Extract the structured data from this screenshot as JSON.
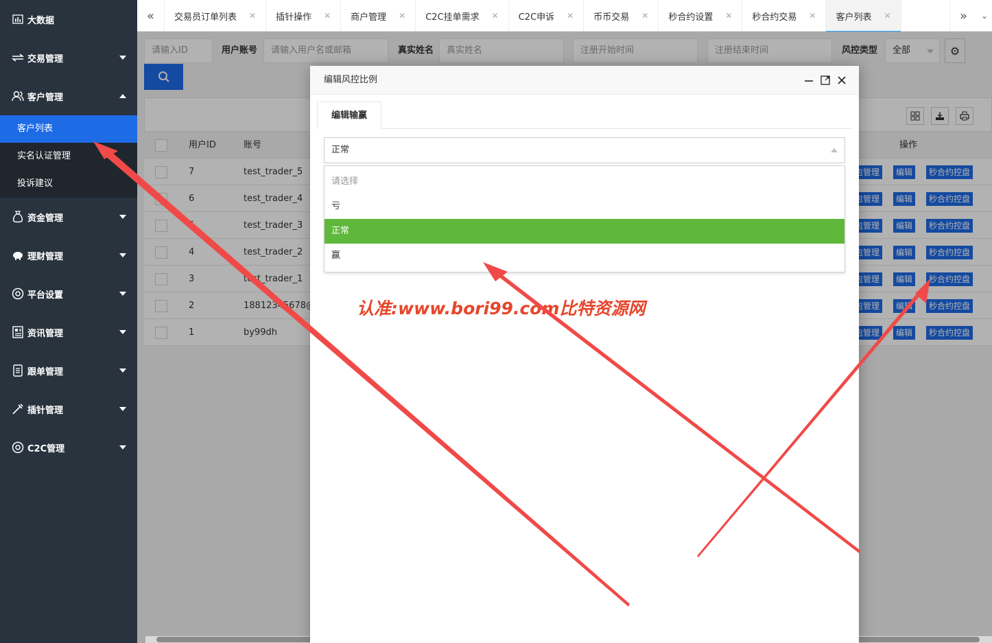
{
  "sidebar": {
    "items": [
      {
        "label": "大数据",
        "icon": "bar-chart-icon"
      },
      {
        "label": "交易管理",
        "icon": "exchange-icon"
      },
      {
        "label": "客户管理",
        "icon": "users-icon"
      },
      {
        "label": "资金管理",
        "icon": "money-bag-icon"
      },
      {
        "label": "理财管理",
        "icon": "piggy-bank-icon"
      },
      {
        "label": "平台设置",
        "icon": "target-icon"
      },
      {
        "label": "资讯管理",
        "icon": "news-icon"
      },
      {
        "label": "跟单管理",
        "icon": "document-icon"
      },
      {
        "label": "插针管理",
        "icon": "needle-icon"
      },
      {
        "label": "C2C管理",
        "icon": "target-icon"
      }
    ],
    "submenu": [
      "客户列表",
      "实名认证管理",
      "投诉建议"
    ]
  },
  "tabs": [
    "交易员订单列表",
    "插针操作",
    "商户管理",
    "C2C挂单需求",
    "C2C申诉",
    "币币交易",
    "秒合约设置",
    "秒合约交易",
    "客户列表"
  ],
  "tabs_active": "客户列表",
  "filters": {
    "id_placeholder": "请输入ID",
    "account_label": "用户账号",
    "account_placeholder": "请输入用户名或邮箱",
    "realname_label": "真实姓名",
    "realname_placeholder": "真实姓名",
    "reg_start_placeholder": "注册开始时间",
    "reg_end_placeholder": "注册结束时间",
    "risk_label": "风控类型",
    "risk_value": "全部"
  },
  "table": {
    "headers": [
      "用户ID",
      "账号",
      "操作"
    ],
    "rows": [
      {
        "id": "7",
        "account": "test_trader_5"
      },
      {
        "id": "6",
        "account": "test_trader_4"
      },
      {
        "id": "5",
        "account": "test_trader_3"
      },
      {
        "id": "4",
        "account": "test_trader_2"
      },
      {
        "id": "3",
        "account": "test_trader_1"
      },
      {
        "id": "2",
        "account": "18812345678@"
      },
      {
        "id": "1",
        "account": "by99dh"
      }
    ],
    "actions": [
      "包管理",
      "编辑",
      "秒合约控盘"
    ]
  },
  "modal": {
    "title": "编辑风控比例",
    "tab": "编辑输赢",
    "select_value": "正常",
    "options": [
      "请选择",
      "亏",
      "正常",
      "赢"
    ],
    "selected_option": "正常"
  },
  "watermark": "认准:www.bori99.com比特资源网",
  "colors": {
    "sidebar_bg": "#28333e",
    "primary": "#1e6be6",
    "selected": "#5fb83b",
    "arrow": "#f04a48"
  }
}
